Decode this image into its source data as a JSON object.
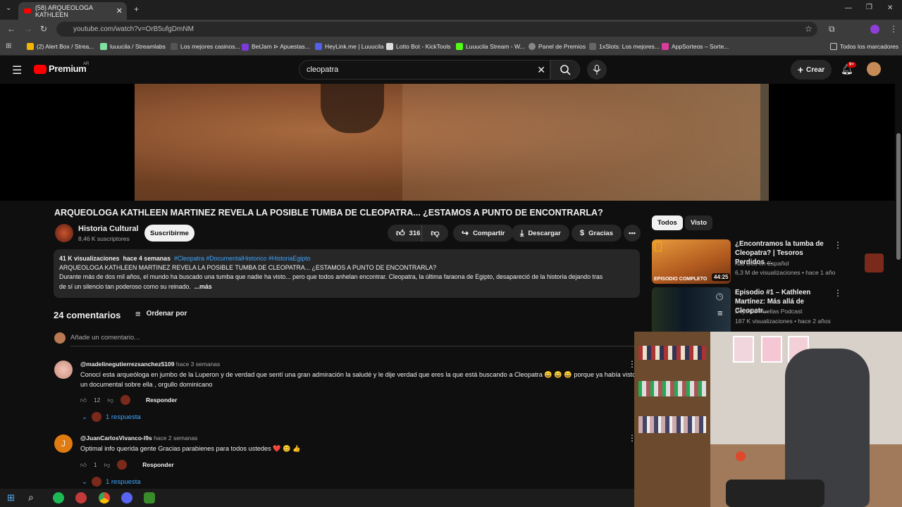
{
  "browser": {
    "tab_title": "(58) ARQUEOLOGA KATHLEEN",
    "url": "youtube.com/watch?v=OrB5ufgDmNM",
    "bookmarks": [
      "(2) Alert Box / Strea...",
      "luuucila / Streamlabs",
      "Los mejores casinos...",
      "BetJam ⊳ Apuestas...",
      "HeyLink.me | Luuucila",
      "Lotto Bot - KickTools",
      "Luuucila Stream - W...",
      "Panel de Premios",
      "1xSlots: Los mejores...",
      "AppSorteos – Sorte..."
    ],
    "all_bookmarks": "Todos los marcadores"
  },
  "header": {
    "logo": "Premium",
    "region": "AR",
    "search_value": "cleopatra",
    "create_label": "Crear",
    "notif_badge": "9+"
  },
  "video": {
    "title": "ARQUEOLOGA KATHLEEN MARTINEZ REVELA LA POSIBLE TUMBA DE CLEOPATRA... ¿ESTAMOS A PUNTO DE ENCONTRARLA?",
    "channel": "Historia Cultural",
    "subs": "8,46 K suscriptores",
    "subscribe": "Suscribirme",
    "likes": "316",
    "share": "Compartir",
    "download": "Descargar",
    "thanks": "Gracias",
    "views": "41 K visualizaciones",
    "age": "hace 4 semanas",
    "tags": "#Cleopatra #DocumentalHistorico #HistoriaEgipto",
    "desc_line1": "ARQUEOLOGA KATHLEEN MARTINEZ REVELA LA POSIBLE TUMBA DE CLEOPATRA... ¿ESTAMOS A PUNTO DE ENCONTRARLA?",
    "desc_line2": "Durante más de dos mil años, el mundo ha buscado una tumba que nadie ha visto... pero que todos anhelan encontrar. Cleopatra, la última faraona de Egipto, desapareció de la historia dejando tras",
    "desc_line3": "de sí un silencio tan poderoso como su reinado.",
    "more": "...más"
  },
  "comments": {
    "count": "24 comentarios",
    "sort": "Ordenar por",
    "add_placeholder": "Añade un comentario...",
    "items": [
      {
        "user": "@madelinegutierrezsanchez5109",
        "age": "hace 3 semanas",
        "text1": "Conocí esta arqueóloga en jumbo de la Luperon y de verdad que sentí una gran admiración la saludé y  le dije verdad que eres la que está buscando a Cleopatra 😄 😄 😄  porque ya había visto",
        "text2": "un documental sobre ella , orgullo dominicano",
        "likes": "12",
        "reply": "Responder",
        "replies": "1 respuesta"
      },
      {
        "user": "@JuanCarlosVivanco-l9s",
        "age": "hace 2 semanas",
        "text1": "Optimal info querida gente Gracias         parabienes para todos ustedes ❤️ 😊 👍",
        "initial": "J",
        "likes": "1",
        "reply": "Responder",
        "replies": "1 respuesta"
      }
    ]
  },
  "sidebar": {
    "chips": [
      "Todos",
      "Visto"
    ],
    "recs": [
      {
        "title": "¿Encontramos la tumba de Cleopatra? | Tesoros Perdidos ...",
        "channel": "Nat Geo en Español",
        "meta": "6,3 M de visualizaciones • hace 1 año",
        "duration": "44:25",
        "thumb_label": "EPISODIO COMPLETO"
      },
      {
        "title": "Episodio #1  – Kathleen Martínez: Más allá de Cleopatr...",
        "channel": "Dejando Huellas Podcast",
        "meta": "187 K visualizaciones • hace 2 años"
      }
    ]
  },
  "colors": {
    "accent": "#ff0000",
    "link": "#3ea6ff"
  }
}
